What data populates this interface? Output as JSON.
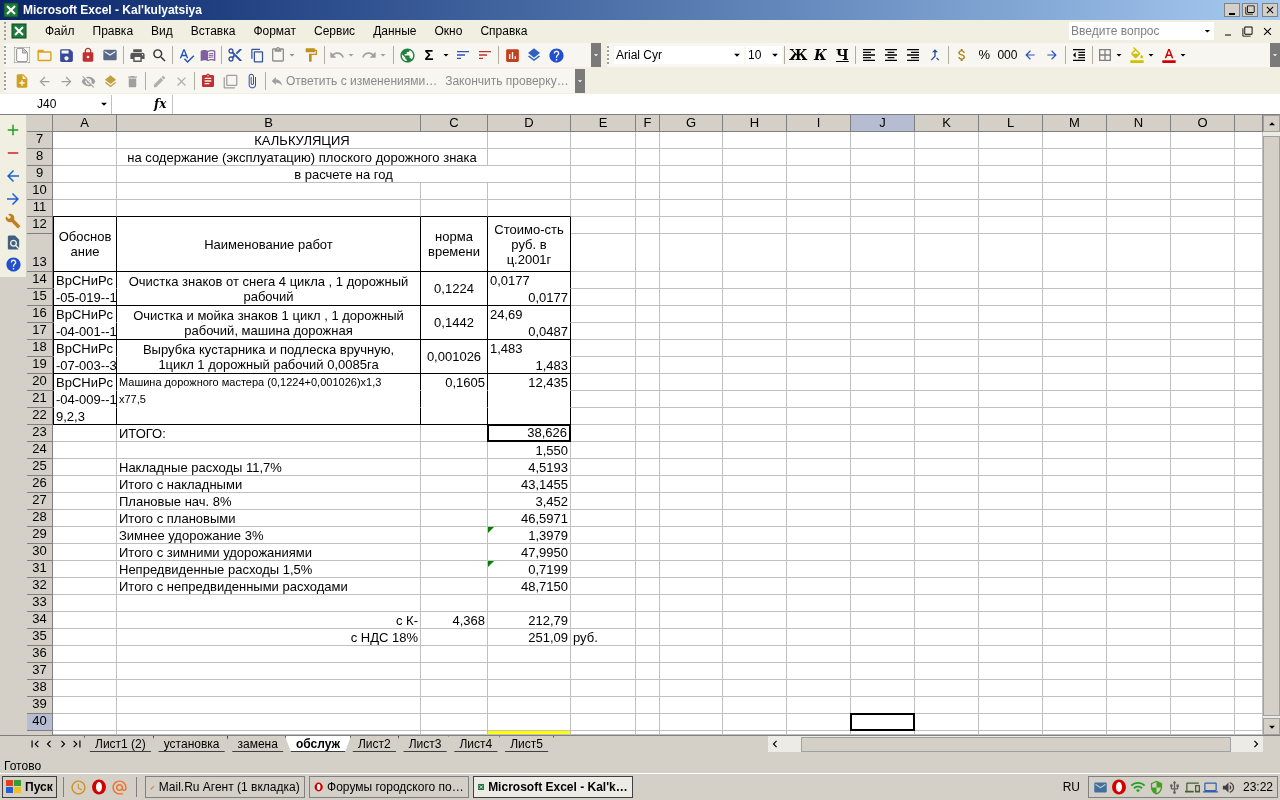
{
  "window": {
    "title": "Microsoft Excel - Kal'kulyatsiya"
  },
  "menu": [
    "Файл",
    "Правка",
    "Вид",
    "Вставка",
    "Формат",
    "Сервис",
    "Данные",
    "Окно",
    "Справка"
  ],
  "help_box": {
    "placeholder": "Введите вопрос"
  },
  "standard_toolbar": {
    "sum": "Σ"
  },
  "format_toolbar": {
    "font": "Arial Cyr",
    "size": "10",
    "bold": "Ж",
    "italic": "К",
    "underline": "Ч",
    "percent": "%",
    "thousands": "000"
  },
  "review_toolbar": {
    "reply": "Ответить с изменениями…",
    "finish": "Закончить проверку…"
  },
  "formula_bar": {
    "name_box": "J40",
    "function_label": "fx"
  },
  "sheet": {
    "columns": [
      {
        "label": "A",
        "selected": false
      },
      {
        "label": "B",
        "selected": false
      },
      {
        "label": "C",
        "selected": false
      },
      {
        "label": "D",
        "selected": false
      },
      {
        "label": "E",
        "selected": false
      },
      {
        "label": "F",
        "selected": false
      },
      {
        "label": "G",
        "selected": false
      },
      {
        "label": "H",
        "selected": false
      },
      {
        "label": "I",
        "selected": false
      },
      {
        "label": "J",
        "selected": true
      },
      {
        "label": "K",
        "selected": false
      },
      {
        "label": "L",
        "selected": false
      },
      {
        "label": "M",
        "selected": false
      },
      {
        "label": "N",
        "selected": false
      },
      {
        "label": "O",
        "selected": false
      }
    ],
    "rows": [
      {
        "label": "7",
        "selected": false,
        "error_mark": false,
        "cells": {
          "B": "КАЛЬКУЛЯЦИЯ"
        }
      },
      {
        "label": "8",
        "selected": false,
        "error_mark": false,
        "cells": {
          "B": "на содержание (эксплуатацию) плоского дорожного знака"
        }
      },
      {
        "label": "9",
        "selected": false,
        "error_mark": false,
        "cells": {
          "B": "в расчете на год"
        }
      },
      {
        "label": "10",
        "selected": false,
        "error_mark": false
      },
      {
        "label": "11",
        "selected": false,
        "error_mark": false
      },
      {
        "label": "12",
        "selected": false,
        "error_mark": false,
        "cells": {
          "A": "Обоснование",
          "B": "Наименование работ",
          "C": "норма времени",
          "D": "Стоимо-сть руб. в ц.2001г"
        }
      },
      {
        "label": "13",
        "selected": false,
        "error_mark": false
      },
      {
        "label": "14",
        "selected": false,
        "error_mark": false,
        "cells": {
          "A": "ВрСНиРс",
          "B": "Очистка знаков от снега 4 цикла , 1 дорожный рабочий",
          "C": "0,1224",
          "D": "0,0177"
        }
      },
      {
        "label": "15",
        "selected": false,
        "error_mark": false,
        "cells": {
          "A": "-05-019--1",
          "D": "0,0177"
        }
      },
      {
        "label": "16",
        "selected": false,
        "error_mark": false,
        "cells": {
          "A": "ВрСНиРс",
          "B": "Очистка и мойка знаков 1 цикл , 1 дорожный рабочий, машина дорожная",
          "C": "0,1442",
          "D": "24,69"
        }
      },
      {
        "label": "17",
        "selected": false,
        "error_mark": false,
        "cells": {
          "A": "-04-001--1",
          "D": "0,0487"
        }
      },
      {
        "label": "18",
        "selected": false,
        "error_mark": false,
        "cells": {
          "A": "ВрСНиРс",
          "B": "Вырубка кустарника и подлеска вручную, 1цикл 1 дорожный рабочий 0,0085га",
          "C": "0,001026",
          "D": "1,483"
        }
      },
      {
        "label": "19",
        "selected": false,
        "error_mark": false,
        "cells": {
          "A": "-07-003--3",
          "D": "1,483"
        }
      },
      {
        "label": "20",
        "selected": false,
        "error_mark": false,
        "cells": {
          "A": "ВрСНиРс",
          "B": "Машина дорожного мастера (0,1224+0,001026)x1,3",
          "C": "0,1605",
          "D": "12,435"
        }
      },
      {
        "label": "21",
        "selected": false,
        "error_mark": false,
        "cells": {
          "A": "-04-009--1",
          "B": "x77,5"
        }
      },
      {
        "label": "22",
        "selected": false,
        "error_mark": false,
        "cells": {
          "A": "9,2,3"
        }
      },
      {
        "label": "23",
        "selected": false,
        "error_mark": false,
        "cells": {
          "B": "ИТОГО:",
          "D": "38,626"
        }
      },
      {
        "label": "24",
        "selected": false,
        "error_mark": false,
        "cells": {
          "D": "1,550"
        }
      },
      {
        "label": "25",
        "selected": false,
        "error_mark": false,
        "cells": {
          "B": "Накладные расходы 11,7%",
          "D": "4,5193"
        }
      },
      {
        "label": "26",
        "selected": false,
        "error_mark": false,
        "cells": {
          "B": "Итого с накладными",
          "D": "43,1455"
        }
      },
      {
        "label": "27",
        "selected": false,
        "error_mark": false,
        "cells": {
          "B": "Плановые нач. 8%",
          "D": "3,452"
        }
      },
      {
        "label": "28",
        "selected": false,
        "error_mark": false,
        "cells": {
          "B": "Итого с плановыми",
          "D": "46,5971"
        }
      },
      {
        "label": "29",
        "selected": false,
        "error_mark": true,
        "cells": {
          "B": "Зимнее удорожание 3%",
          "D": "1,3979"
        }
      },
      {
        "label": "30",
        "selected": false,
        "error_mark": false,
        "cells": {
          "B": "Итого с зимними удорожаниями",
          "D": "47,9950"
        }
      },
      {
        "label": "31",
        "selected": false,
        "error_mark": true,
        "cells": {
          "B": "Непредвиденные расходы 1,5%",
          "D": "0,7199"
        }
      },
      {
        "label": "32",
        "selected": false,
        "error_mark": false,
        "cells": {
          "B": "Итого с непредвиденными расходами",
          "D": "48,7150"
        }
      },
      {
        "label": "33",
        "selected": false,
        "error_mark": false
      },
      {
        "label": "34",
        "selected": false,
        "error_mark": false,
        "cells": {
          "B": "с К-",
          "C": "4,368",
          "D": "212,79"
        }
      },
      {
        "label": "35",
        "selected": false,
        "error_mark": false,
        "cells": {
          "B": "с НДС 18%",
          "D": "251,09",
          "E": "руб."
        }
      },
      {
        "label": "36",
        "selected": false,
        "error_mark": false
      },
      {
        "label": "37",
        "selected": false,
        "error_mark": false
      },
      {
        "label": "38",
        "selected": false,
        "error_mark": false
      },
      {
        "label": "39",
        "selected": false,
        "error_mark": false
      },
      {
        "label": "40",
        "selected": true,
        "error_mark": false
      }
    ]
  },
  "sheet_tabs": [
    {
      "label": "Лист1 (2)",
      "selected": false
    },
    {
      "label": "установка",
      "selected": false
    },
    {
      "label": "замена",
      "selected": false
    },
    {
      "label": "обслуж",
      "selected": true
    },
    {
      "label": "Лист2",
      "selected": false
    },
    {
      "label": "Лист3",
      "selected": false
    },
    {
      "label": "Лист4",
      "selected": false
    },
    {
      "label": "Лист5",
      "selected": false
    }
  ],
  "status_bar": {
    "text": "Готово"
  },
  "taskbar": {
    "start": "Пуск",
    "tasks": [
      {
        "label": "Mail.Ru Агент (1 вкладка)",
        "kind": "pencil",
        "selected": false
      },
      {
        "label": "Форумы городского по…",
        "kind": "browser",
        "selected": false
      },
      {
        "label": "Microsoft Excel - Kal'k…",
        "kind": "excel",
        "selected": true
      }
    ],
    "language": "RU",
    "clock": "23:22"
  }
}
